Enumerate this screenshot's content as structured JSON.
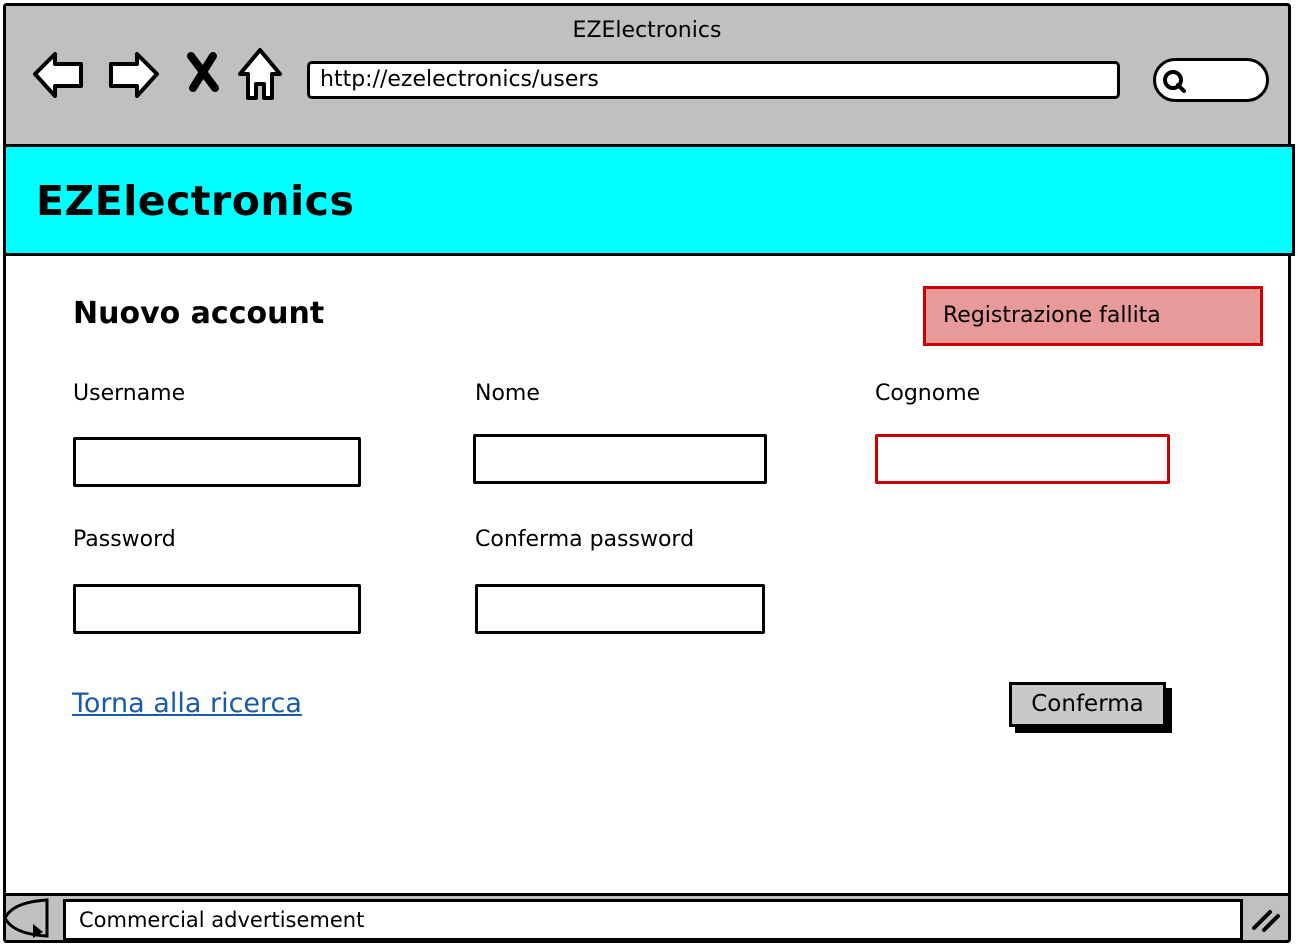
{
  "window": {
    "title": "EZElectronics"
  },
  "browser": {
    "url": "http://ezelectronics/users",
    "icons": [
      "back-arrow-icon",
      "forward-arrow-icon",
      "close-x-icon",
      "home-icon",
      "search-icon"
    ]
  },
  "header": {
    "brand": "EZElectronics",
    "color": "#00ffff"
  },
  "form": {
    "title": "Nuovo account",
    "error_message": "Registrazione fallita",
    "fields": {
      "username": {
        "label": "Username",
        "value": ""
      },
      "nome": {
        "label": "Nome",
        "value": ""
      },
      "cognome": {
        "label": "Cognome",
        "value": "",
        "error": true
      },
      "password": {
        "label": "Password",
        "value": ""
      },
      "conferma_password": {
        "label": "Conferma password",
        "value": ""
      }
    },
    "back_link": "Torna alla ricerca",
    "submit_label": "Conferma"
  },
  "footer": {
    "ad_text": "Commercial advertisement"
  },
  "colors": {
    "error_bg": "#e89a9a",
    "error_border": "#cc0000",
    "link": "#1a5aa6"
  }
}
